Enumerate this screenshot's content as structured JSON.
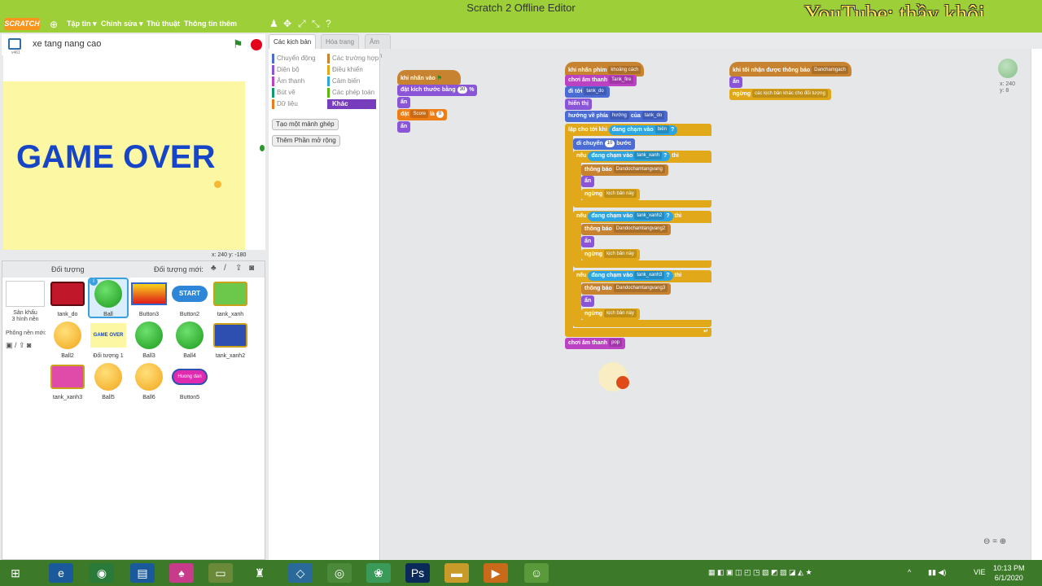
{
  "window": {
    "title": "Scratch 2 Offline Editor",
    "watermark": "YouTube: thầy khôi"
  },
  "menu": {
    "logo": "SCRATCH",
    "items": [
      "Tập tin ▾",
      "Chỉnh sửa ▾",
      "Thủ thuật",
      "Thông tin thêm"
    ]
  },
  "stage": {
    "project_name": "xe tang nang cao",
    "version": "v461",
    "game_over_text": "GAME OVER",
    "coords": "x: 240  y: -180"
  },
  "sprites": {
    "header": "Đối tượng",
    "new_label": "Đối tượng mới:",
    "stage_label": "Sân khấu",
    "stage_sub": "3 hình nền",
    "backdrop_label": "Phông nền mới:",
    "items": [
      "tank_do",
      "Ball",
      "Button3",
      "Button2",
      "tank_xanh",
      "Ball2",
      "Đối tượng 1",
      "Ball3",
      "Ball4",
      "tank_xanh2",
      "tank_xanh3",
      "Ball5",
      "Ball6",
      "Button5"
    ],
    "button2_text": "START",
    "sprite1_text": "GAME OVER",
    "button5_text": "Huong dan",
    "info_badge": "i"
  },
  "tabs": [
    "Các kịch bản",
    "Hóa trang",
    "Âm thanh"
  ],
  "palette": {
    "categories_left": [
      "Chuyển động",
      "Diện bộ",
      "Âm thanh",
      "Bút vẽ",
      "Dữ liệu"
    ],
    "categories_right": [
      "Các trường hợp",
      "Điều khiển",
      "Cảm biến",
      "Các phép toán",
      "Khác"
    ],
    "colors_left": [
      "#4a6cd4",
      "#8a55d7",
      "#bb42c3",
      "#0e9a6c",
      "#ee7d16"
    ],
    "colors_right": [
      "#c88330",
      "#e1a91a",
      "#2ca5e2",
      "#5cb712",
      "#773dbd"
    ],
    "btn_make_block": "Tạo một mảnh ghép",
    "btn_extension": "Thêm Phần mở rộng"
  },
  "script1": {
    "hat": "khi nhấn vào",
    "set_size": "đặt kích thước bằng",
    "set_size_val": "30",
    "set_size_unit": "%",
    "hide": "ẩn",
    "set_var": "đặt",
    "var_name": "Score",
    "var_to": "là",
    "var_val": "0",
    "hide2": "ẩn"
  },
  "script2": {
    "hat": "khi nhấn phím",
    "key": "khoảng cách",
    "play_sound": "chơi âm thanh",
    "sound": "Tank_fire",
    "goto": "đi tới",
    "goto_target": "tank_do",
    "show": "hiển thị",
    "point": "hướng về phía",
    "point_dd": "hướng",
    "point_of": "của",
    "point_target": "tank_do",
    "repeat": "lặp cho tới khi",
    "touching": "đang chạm vào",
    "edge": "biên",
    "q": "?",
    "move": "di chuyển",
    "move_val": "10",
    "move_unit": "bước",
    "if": "nếu",
    "then": "thì",
    "t1": "tank_xanh",
    "t2": "tank_xanh2",
    "t3": "tank_xanh3",
    "broadcast": "thông báo",
    "b1": "Dandochamtangvang",
    "b2": "Dandochamtangvang2",
    "b3": "Dandochamtangvang3",
    "hide": "ẩn",
    "stop": "ngừng",
    "stop_opt": "kịch bản này",
    "end_sound": "chơi âm thanh",
    "end_sound_name": "pop"
  },
  "script3": {
    "hat": "khi tôi nhận được thông báo",
    "msg": "Danchamgach",
    "hide": "ẩn",
    "stop": "ngừng",
    "stop_opt": "các kịch bản khác cho đối tượng"
  },
  "sprite_info": {
    "x": "x: 240",
    "y": "y: 8"
  },
  "taskbar": {
    "lang": "VIE",
    "time": "10:13 PM",
    "date": "6/1/2020"
  }
}
